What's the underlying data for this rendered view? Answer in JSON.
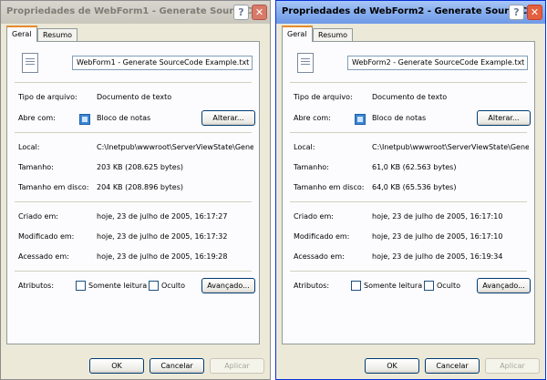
{
  "windows": [
    {
      "title": "Propriedades de WebForm1 - Generate SourceCo",
      "state": "inactive",
      "tabs": [
        "Geral",
        "Resumo"
      ],
      "filename": "WebForm1 - Generate SourceCode Example.txt",
      "type_label": "Tipo de arquivo:",
      "type_value": "Documento de texto",
      "opens_label": "Abre com:",
      "opens_value": "Bloco de notas",
      "change_button": "Alterar...",
      "location_label": "Local:",
      "location_value": "C:\\Inetpub\\wwwroot\\ServerViewState\\Gene",
      "size_label": "Tamanho:",
      "size_value": "203 KB (208.625 bytes)",
      "disksize_label": "Tamanho em disco:",
      "disksize_value": "204 KB (208.896 bytes)",
      "created_label": "Criado em:",
      "created_value": "hoje, 23 de julho de 2005, 16:17:27",
      "modified_label": "Modificado em:",
      "modified_value": "hoje, 23 de julho de 2005, 16:17:32",
      "accessed_label": "Acessado em:",
      "accessed_value": "hoje, 23 de julho de 2005, 16:19:28",
      "attributes_label": "Atributos:",
      "readonly_label": "Somente leitura",
      "hidden_label": "Oculto",
      "advanced_button": "Avançado...",
      "ok_button": "OK",
      "cancel_button": "Cancelar",
      "apply_button": "Aplicar",
      "help_glyph": "?",
      "close_glyph": "✕"
    },
    {
      "title": "Propriedades de WebForm2 - Generate SourceCo",
      "state": "active",
      "tabs": [
        "Geral",
        "Resumo"
      ],
      "filename": "WebForm2 - Generate SourceCode Example.txt",
      "type_label": "Tipo de arquivo:",
      "type_value": "Documento de texto",
      "opens_label": "Abre com:",
      "opens_value": "Bloco de notas",
      "change_button": "Alterar...",
      "location_label": "Local:",
      "location_value": "C:\\Inetpub\\wwwroot\\ServerViewState\\Gene",
      "size_label": "Tamanho:",
      "size_value": "61,0 KB (62.563 bytes)",
      "disksize_label": "Tamanho em disco:",
      "disksize_value": "64,0 KB (65.536 bytes)",
      "created_label": "Criado em:",
      "created_value": "hoje, 23 de julho de 2005, 16:17:10",
      "modified_label": "Modificado em:",
      "modified_value": "hoje, 23 de julho de 2005, 16:17:10",
      "accessed_label": "Acessado em:",
      "accessed_value": "hoje, 23 de julho de 2005, 16:19:34",
      "attributes_label": "Atributos:",
      "readonly_label": "Somente leitura",
      "hidden_label": "Oculto",
      "advanced_button": "Avançado...",
      "ok_button": "OK",
      "cancel_button": "Cancelar",
      "apply_button": "Aplicar",
      "help_glyph": "?",
      "close_glyph": "✕"
    }
  ]
}
